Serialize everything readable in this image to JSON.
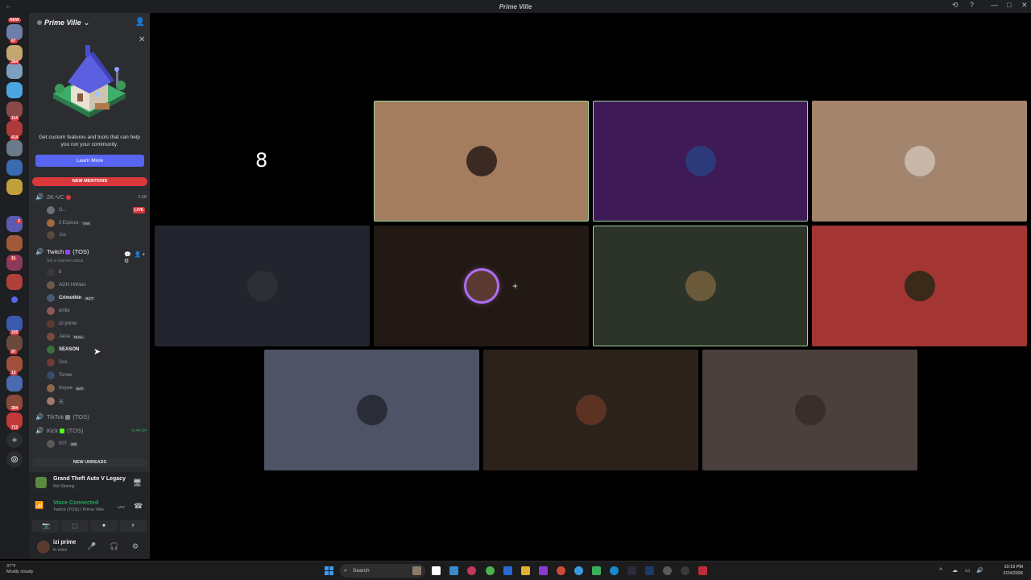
{
  "window": {
    "title": "Prime Ville",
    "back_glyph": "←",
    "controls": [
      "⟲",
      "?",
      "—",
      "□",
      "✕"
    ]
  },
  "server_rail": {
    "new_badge": "NEW",
    "badges": [
      "67",
      "364",
      "114",
      "414",
      "3",
      "11",
      "220",
      "97",
      "13",
      "394",
      "712"
    ],
    "add_glyph": "+",
    "discover_glyph": "⊚"
  },
  "sidebar": {
    "server_name": "Prime Ville",
    "chevron": "⌄",
    "invite_glyph": "👤",
    "close_glyph": "✕",
    "promo_text": "Get custom features and tools that can help you run your community.",
    "learn_more": "Learn More",
    "new_mentions": "NEW MENTIONS",
    "new_unreads": "NEW UNREADS",
    "channels": [
      {
        "name": "2K-VC",
        "time": "3:08",
        "state": "dim"
      },
      {
        "name": "Twitch",
        "suffix": "(TOS)",
        "state": "active",
        "color": "#9146ff",
        "topic": "Set a channel status"
      },
      {
        "name": "TikTok",
        "suffix": "(TOS)",
        "state": "dim",
        "color": "#80848e"
      },
      {
        "name": "Kick",
        "suffix": "(TOS)",
        "time": "6:44:04",
        "state": "dim",
        "color": "#53fc18"
      }
    ],
    "channel_icons": "💬 👤+ ⚙",
    "vc_2k_users": [
      {
        "name": "G...",
        "live": "LIVE",
        "color": "#6d6f78"
      },
      {
        "name": "Il Expoze",
        "tag": "YAK",
        "color": "#a06a3c"
      },
      {
        "name": "Jss",
        "color": "#5a4a3c"
      }
    ],
    "twitch_users": [
      {
        "name": "8",
        "color": "#3a3a3a",
        "bold": false
      },
      {
        "name": "AON HitMan",
        "color": "#6e5a48",
        "bold": false
      },
      {
        "name": "Crimothin",
        "tag": "ACT",
        "color": "#4a5a6e",
        "bold": true
      },
      {
        "name": "errtle",
        "color": "#8c5a5a",
        "bold": false
      },
      {
        "name": "izi prime",
        "color": "#5b3a2e",
        "bold": false
      },
      {
        "name": "Jasia",
        "tag": "NULL",
        "color": "#7a4a3a",
        "bold": false
      },
      {
        "name": "SEASON",
        "color": "#3a6e3a",
        "bold": true
      },
      {
        "name": "Sos",
        "color": "#6e3a3a",
        "bold": false
      },
      {
        "name": "Tonee",
        "color": "#3a4a6e",
        "bold": false
      },
      {
        "name": "Koyee",
        "tag": "BAT",
        "color": "#8a6a4a",
        "bold": false
      },
      {
        "name": "天",
        "color": "#a07a6a",
        "bold": false
      }
    ],
    "kick_users": [
      {
        "name": "007",
        "tag": "30k",
        "color": "#5a5a5a"
      }
    ]
  },
  "activity": {
    "game": "Grand Theft Auto V Legacy",
    "status": "Not Sharing",
    "screen_glyph": "🖥"
  },
  "voice_panel": {
    "status": "Voice Connected",
    "channel_path": "Twitch (TOS) / Prime Ville",
    "signal_glyph": "📶",
    "wave_glyph": "〰",
    "disconnect_glyph": "☎",
    "buttons": [
      "📷",
      "⬚",
      "✦",
      "⚡"
    ]
  },
  "user": {
    "name": "izi prime",
    "status": "In voice",
    "mic_glyph": "🎤",
    "headset_glyph": "🎧",
    "settings_glyph": "⚙"
  },
  "video_tiles": [
    {
      "name": "tile-empty-8",
      "bg": "#000000",
      "label": "8",
      "speaking": false
    },
    {
      "name": "tile-user-1",
      "bg": "#a47c5e",
      "avatar": "#3b2a22",
      "speaking": true
    },
    {
      "name": "tile-user-2",
      "bg": "#3e1a56",
      "avatar": "#2c3a7a",
      "speaking": true
    },
    {
      "name": "tile-user-3",
      "bg": "#a3846c",
      "avatar": "#c7b7a8",
      "speaking": false
    },
    {
      "name": "tile-user-4",
      "bg": "#23252e",
      "avatar": "#2e2e36",
      "speaking": false
    },
    {
      "name": "tile-user-5",
      "bg": "#221915",
      "avatar": "#5a3a32",
      "speaking": false,
      "ring": true
    },
    {
      "name": "tile-user-6",
      "bg": "#2c3329",
      "avatar": "#6a5a3a",
      "speaking": true
    },
    {
      "name": "tile-user-7",
      "bg": "#a33532",
      "avatar": "#3a2a1a",
      "speaking": false
    },
    {
      "name": "tile-user-8",
      "bg": "#4e5466",
      "avatar": "#2a2c38",
      "speaking": false
    },
    {
      "name": "tile-user-9",
      "bg": "#2c221c",
      "avatar": "#5c3222",
      "speaking": false
    },
    {
      "name": "tile-user-10",
      "bg": "#4b403e",
      "avatar": "#3a2e2a",
      "speaking": false
    }
  ],
  "plus_glyph": "+",
  "taskbar": {
    "weather_temp": "37°F",
    "weather_desc": "Mostly cloudy",
    "search_placeholder": "Search",
    "search_glyph": "⌕",
    "time": "10:19 PM",
    "date": "2/24/2026",
    "tray": [
      "˄",
      "☁",
      "▭",
      "🔊"
    ]
  },
  "cursor_glyph": "➤"
}
